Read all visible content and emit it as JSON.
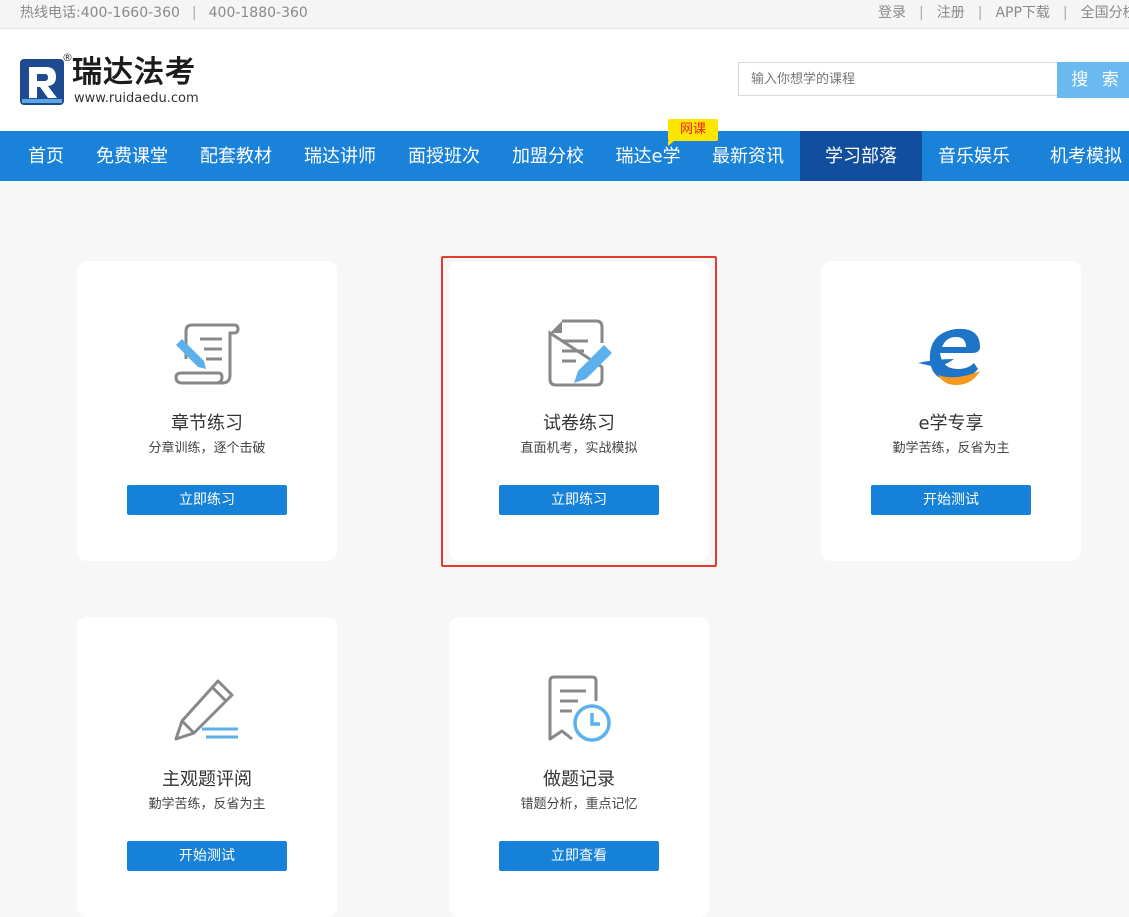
{
  "topbar": {
    "hotline_label": "热线电话:400-1660-360",
    "hotline_second": "400-1880-360",
    "separator": "|",
    "login": "登录",
    "register": "注册",
    "app_download": "APP下载",
    "branches": "全国分校"
  },
  "header": {
    "brand_name": "瑞达法考",
    "brand_url": "www.ruidaedu.com",
    "registered_mark": "®",
    "search": {
      "placeholder": "输入你想学的课程",
      "button_label": "搜 索"
    }
  },
  "nav": {
    "badge": "网课",
    "active_index": 8,
    "items": [
      {
        "label": "首页"
      },
      {
        "label": "免费课堂"
      },
      {
        "label": "配套教材"
      },
      {
        "label": "瑞达讲师"
      },
      {
        "label": "面授班次"
      },
      {
        "label": "加盟分校"
      },
      {
        "label": "瑞达e学"
      },
      {
        "label": "最新资讯"
      },
      {
        "label": "学习部落"
      },
      {
        "label": "音乐娱乐"
      },
      {
        "label": "机考模拟"
      }
    ]
  },
  "cards": [
    {
      "icon": "chapter-scroll-icon",
      "title": "章节练习",
      "subtitle": "分章训练，逐个击破",
      "button": "立即练习"
    },
    {
      "icon": "exam-paper-icon",
      "title": "试卷练习",
      "subtitle": "直面机考，实战模拟",
      "button": "立即练习",
      "highlighted": true
    },
    {
      "icon": "e-learning-logo-icon",
      "title": "e学专享",
      "subtitle": "勤学苦练，反省为主",
      "button": "开始测试"
    },
    {
      "icon": "pencil-icon",
      "title": "主观题评阅",
      "subtitle": "勤学苦练，反省为主",
      "button": "开始测试"
    },
    {
      "icon": "record-clock-icon",
      "title": "做题记录",
      "subtitle": "错题分析，重点记忆",
      "button": "立即查看"
    }
  ],
  "colors": {
    "nav_bg": "#1a82d8",
    "nav_active": "#114f9e",
    "button": "#1681d9",
    "search_button": "#6ab9f0",
    "highlight_border": "#e43a30",
    "badge_bg": "#ffe600"
  }
}
